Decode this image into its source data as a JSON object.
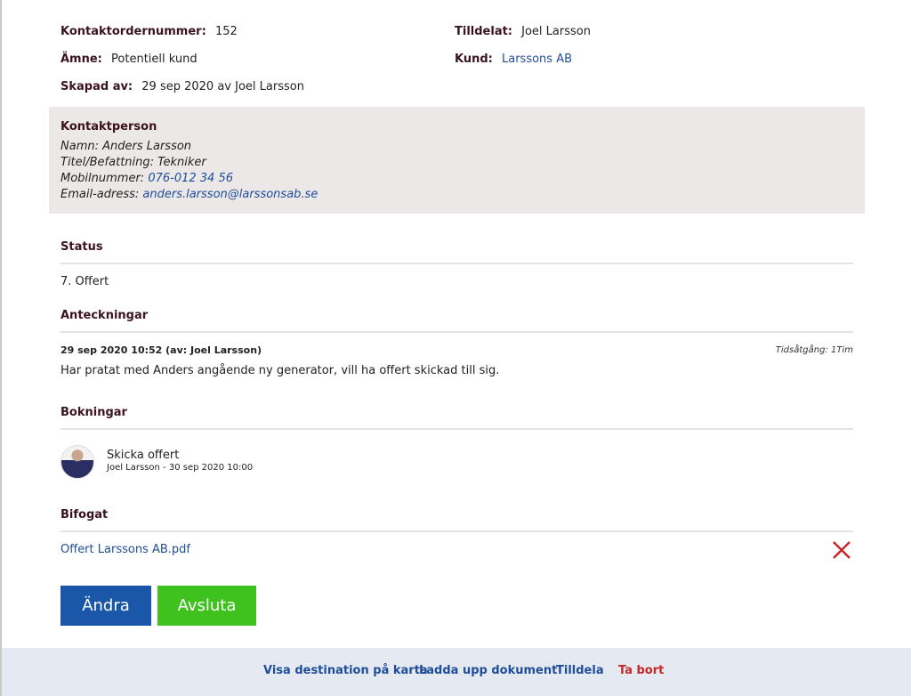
{
  "order": {
    "number_label": "Kontaktordernummer:",
    "number_value": "152",
    "subject_label": "Ämne:",
    "subject_value": "Potentiell kund",
    "created_label": "Skapad av:",
    "created_value": "29 sep 2020 av Joel Larsson",
    "assigned_label": "Tilldelat:",
    "assigned_value": "Joel Larsson",
    "customer_label": "Kund:",
    "customer_value": "Larssons AB"
  },
  "contact": {
    "title": "Kontaktperson",
    "name_label": "Namn:",
    "name_value": "Anders Larsson",
    "title_label": "Titel/Befattning:",
    "title_value": "Tekniker",
    "mobile_label": "Mobilnummer:",
    "mobile_value": "076-012 34 56",
    "email_label": "Email-adress:",
    "email_value": "anders.larsson@larssonsab.se"
  },
  "status": {
    "title": "Status",
    "value": "7. Offert"
  },
  "notes": {
    "title": "Anteckningar",
    "meta": "29 sep 2020 10:52 (av: Joel Larsson)",
    "time_spent": "Tidsåtgång: 1Tim",
    "text": "Har pratat med Anders angående ny generator, vill ha offert skickad till sig."
  },
  "bookings": {
    "title": "Bokningar",
    "item_title": "Skicka offert",
    "item_sub": "Joel Larsson - 30 sep 2020 10:00"
  },
  "attachments": {
    "title": "Bifogat",
    "file_name": "Offert Larssons AB.pdf",
    "delete_icon": "close-icon"
  },
  "buttons": {
    "edit": "Ändra",
    "finish": "Avsluta"
  },
  "footer": {
    "map": "Visa destination på karta",
    "upload": "Ladda upp dokument",
    "assign": "Tilldela",
    "delete": "Ta bort"
  },
  "colors": {
    "primary": "#1b57a8",
    "success": "#3fc11e",
    "danger": "#c62828",
    "link": "#1f4d9a"
  }
}
